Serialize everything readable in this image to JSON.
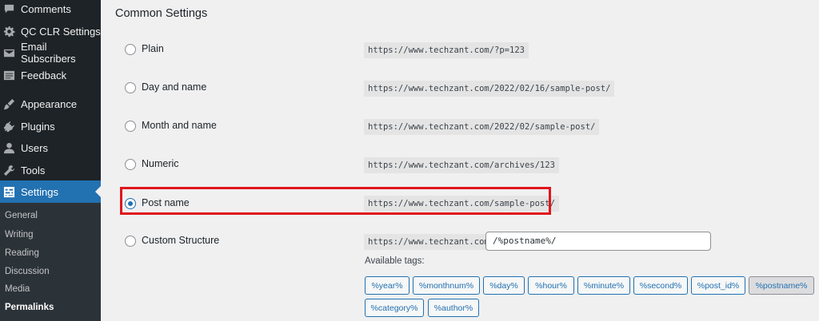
{
  "sidebar": {
    "items": [
      {
        "label": "Comments",
        "icon": "comments-icon"
      },
      {
        "label": "QC CLR Settings",
        "icon": "gear-icon"
      },
      {
        "label": "Email Subscribers",
        "icon": "email-icon"
      },
      {
        "label": "Feedback",
        "icon": "feedback-icon"
      },
      {
        "label": "Appearance",
        "icon": "appearance-icon"
      },
      {
        "label": "Plugins",
        "icon": "plugins-icon"
      },
      {
        "label": "Users",
        "icon": "users-icon"
      },
      {
        "label": "Tools",
        "icon": "tools-icon"
      },
      {
        "label": "Settings",
        "icon": "settings-icon",
        "active": true
      }
    ],
    "submenu": [
      "General",
      "Writing",
      "Reading",
      "Discussion",
      "Media",
      "Permalinks"
    ],
    "current_submenu": "Permalinks"
  },
  "main": {
    "section_title": "Common Settings",
    "options": [
      {
        "label": "Plain",
        "example": "https://www.techzant.com/?p=123",
        "checked": false
      },
      {
        "label": "Day and name",
        "example": "https://www.techzant.com/2022/02/16/sample-post/",
        "checked": false
      },
      {
        "label": "Month and name",
        "example": "https://www.techzant.com/2022/02/sample-post/",
        "checked": false
      },
      {
        "label": "Numeric",
        "example": "https://www.techzant.com/archives/123",
        "checked": false
      },
      {
        "label": "Post name",
        "example": "https://www.techzant.com/sample-post/",
        "checked": true
      },
      {
        "label": "Custom Structure",
        "example": "https://www.techzant.com",
        "checked": false
      }
    ],
    "custom_structure_value": "/%postname%/",
    "available_tags_label": "Available tags:",
    "tags": [
      "%year%",
      "%monthnum%",
      "%day%",
      "%hour%",
      "%minute%",
      "%second%",
      "%post_id%",
      "%postname%",
      "%category%",
      "%author%"
    ],
    "active_tag": "%postname%"
  },
  "colors": {
    "sidebar_bg": "#1d2327",
    "accent": "#2271b1",
    "highlight_border": "#e0151c"
  }
}
